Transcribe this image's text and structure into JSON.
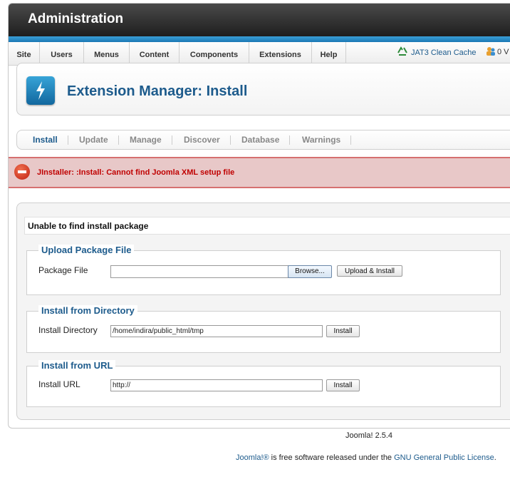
{
  "header": {
    "title": "Administration"
  },
  "menu": {
    "items": [
      "Site",
      "Users",
      "Menus",
      "Content",
      "Components",
      "Extensions",
      "Help"
    ],
    "cache_label": "JAT3 Clean Cache",
    "online_label": "0 V"
  },
  "toolbar": {
    "title": "Extension Manager: Install",
    "icon": "lightning-icon"
  },
  "submenu": {
    "tabs": [
      "Install",
      "Update",
      "Manage",
      "Discover",
      "Database",
      "Warnings"
    ],
    "active": "Install"
  },
  "error": {
    "message": "JInstaller: :Install: Cannot find Joomla XML setup file"
  },
  "main": {
    "info": "Unable to find install package",
    "upload": {
      "legend": "Upload Package File",
      "label": "Package File",
      "file_value": "",
      "browse_label": "Browse...",
      "submit_label": "Upload & Install"
    },
    "directory": {
      "legend": "Install from Directory",
      "label": "Install Directory",
      "value": "/home/indira/public_html/tmp",
      "submit_label": "Install"
    },
    "url": {
      "legend": "Install from URL",
      "label": "Install URL",
      "value": "http://",
      "submit_label": "Install"
    }
  },
  "footer": {
    "version": "Joomla! 2.5.4",
    "license_link1": "Joomla!®",
    "license_text": " is free software released under the ",
    "license_link2": "GNU General Public License",
    "license_end": "."
  },
  "colors": {
    "accent": "#1d5b8c",
    "error": "#c00000",
    "error_bg": "#e8c8c8"
  }
}
